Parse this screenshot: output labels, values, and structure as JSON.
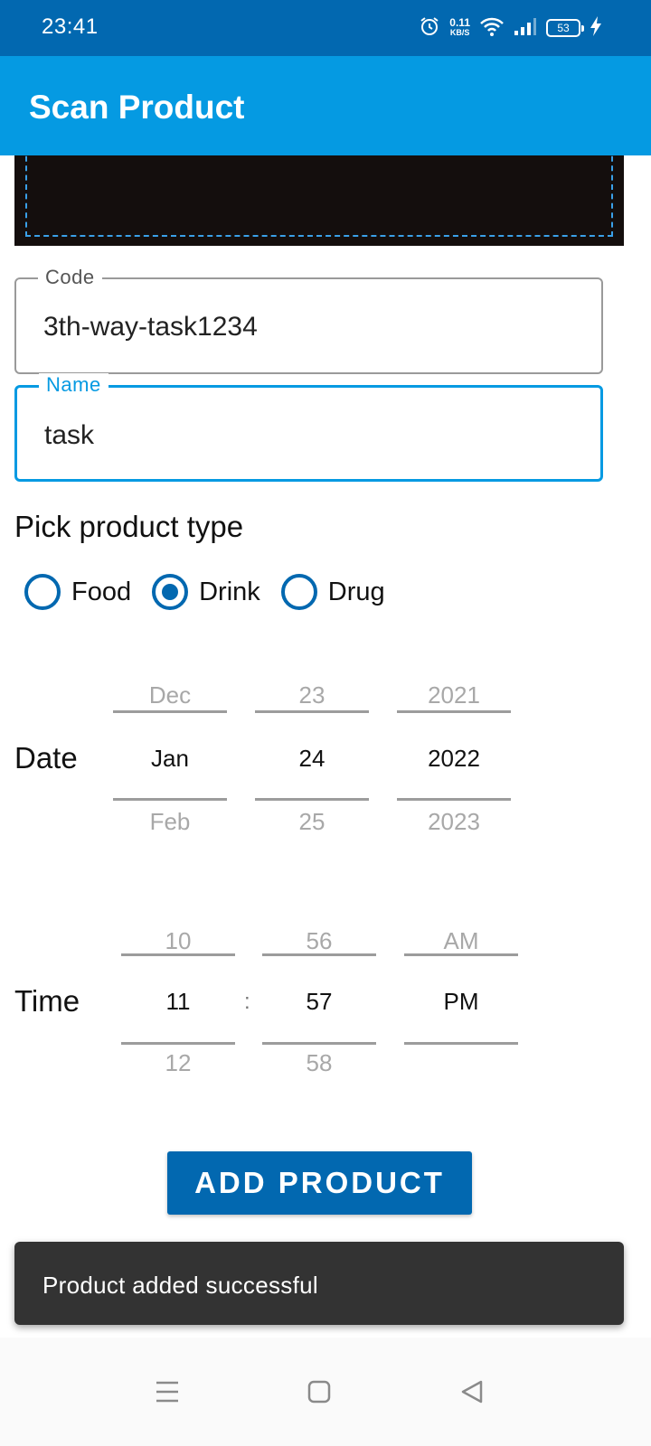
{
  "status_bar": {
    "time": "23:41",
    "net_speed_value": "0.11",
    "net_speed_unit": "KB/S",
    "battery": "53",
    "icons": [
      "alarm-icon",
      "wifi-icon",
      "signal-icon",
      "battery-icon",
      "charging-icon"
    ]
  },
  "app_bar": {
    "title": "Scan Product"
  },
  "form": {
    "code": {
      "label": "Code",
      "value": "3th-way-task1234"
    },
    "name": {
      "label": "Name",
      "value": "task"
    }
  },
  "product_type": {
    "label": "Pick product type",
    "options": [
      {
        "label": "Food",
        "checked": false
      },
      {
        "label": "Drink",
        "checked": true
      },
      {
        "label": "Drug",
        "checked": false
      }
    ]
  },
  "date": {
    "label": "Date",
    "month": {
      "prev": "Dec",
      "current": "Jan",
      "next": "Feb"
    },
    "day": {
      "prev": "23",
      "current": "24",
      "next": "25"
    },
    "year": {
      "prev": "2021",
      "current": "2022",
      "next": "2023"
    }
  },
  "time": {
    "label": "Time",
    "separator": ":",
    "hour": {
      "prev": "10",
      "current": "11",
      "next": "12"
    },
    "minute": {
      "prev": "56",
      "current": "57",
      "next": "58"
    },
    "ampm": {
      "prev": "AM",
      "current": "PM",
      "next": ""
    }
  },
  "add_button": {
    "label": "ADD PRODUCT"
  },
  "snackbar": {
    "message": "Product added successful"
  },
  "nav_bar": {
    "icons": [
      "menu-icon",
      "home-icon",
      "back-icon"
    ]
  },
  "colors": {
    "status_bar": "#0268b0",
    "app_bar": "#059ae2",
    "primary": "#0268b0",
    "focus": "#059ae2",
    "snackbar": "#333333"
  }
}
